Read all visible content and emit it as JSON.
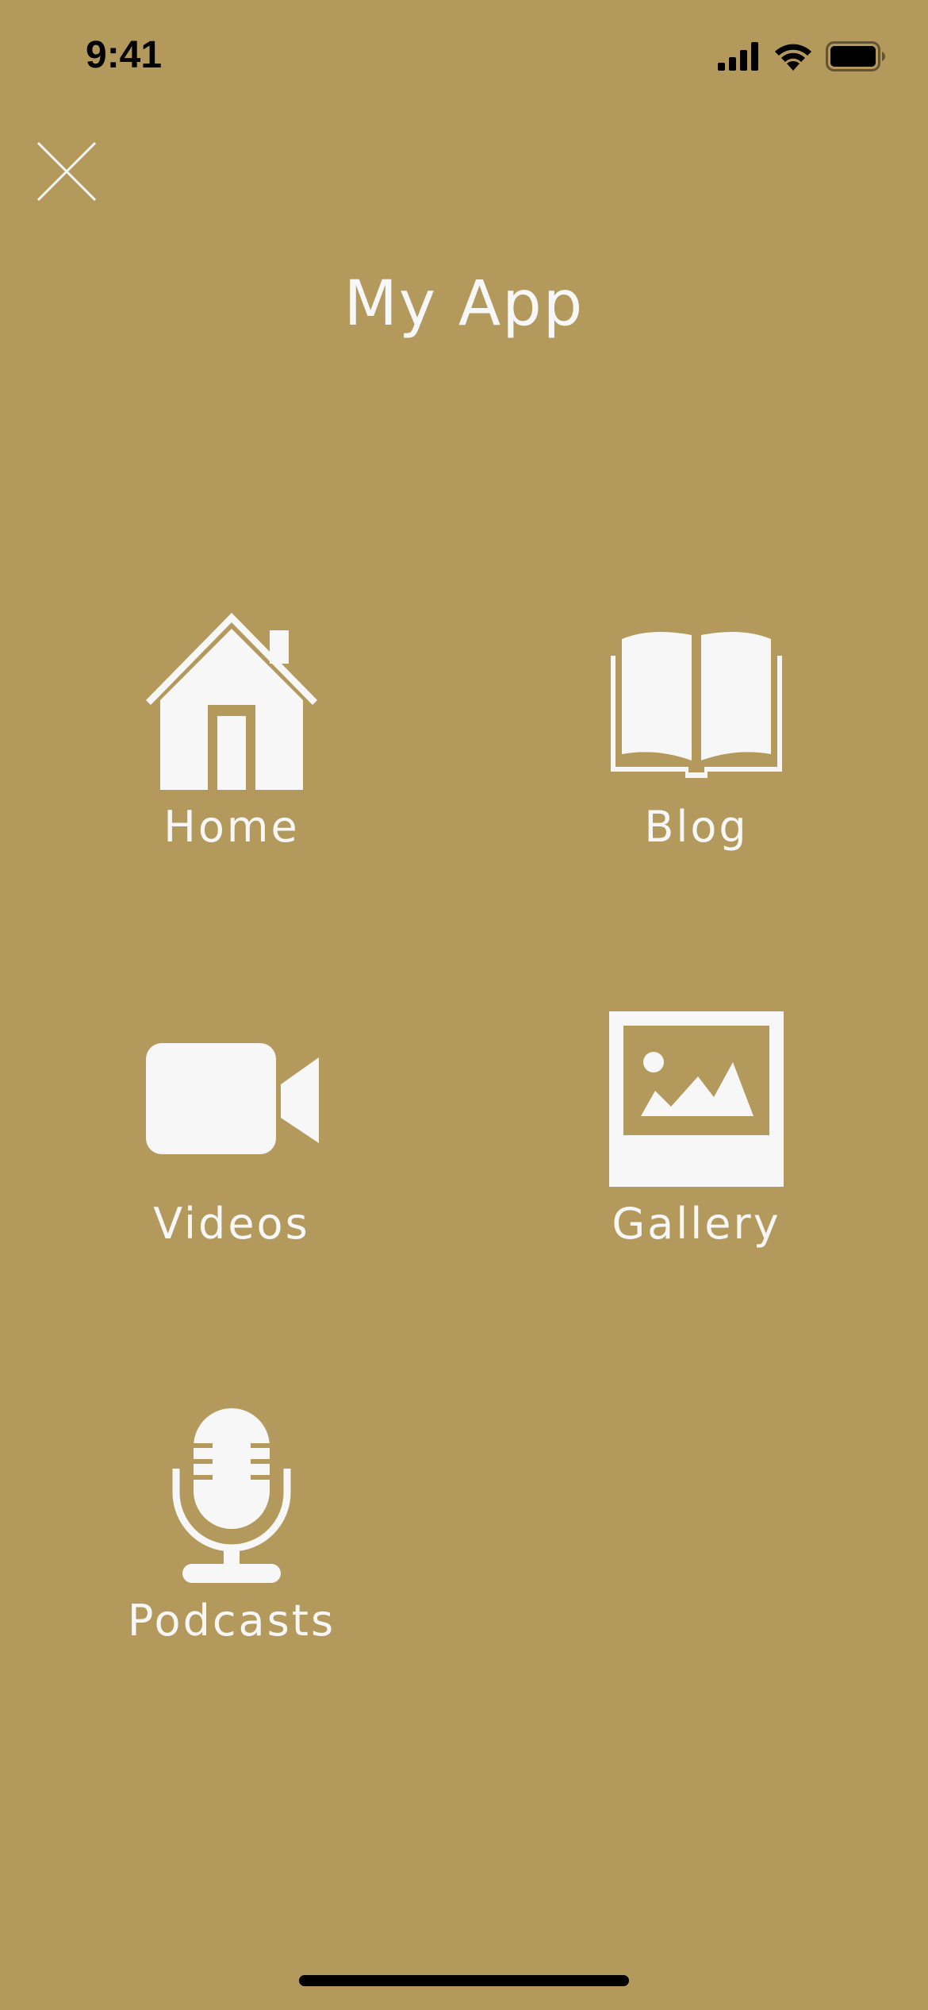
{
  "status_bar": {
    "time": "9:41",
    "signal_icon": "cellular-signal-icon",
    "wifi_icon": "wifi-icon",
    "battery_icon": "battery-icon"
  },
  "close_icon": "close-icon",
  "app_title": "My App",
  "nav_items": [
    {
      "label": "Home",
      "icon": "house-icon"
    },
    {
      "label": "Blog",
      "icon": "open-book-icon"
    },
    {
      "label": "Videos",
      "icon": "video-camera-icon"
    },
    {
      "label": "Gallery",
      "icon": "picture-icon"
    },
    {
      "label": "Podcasts",
      "icon": "microphone-icon"
    }
  ],
  "colors": {
    "background": "#b3995c",
    "foreground": "#f7f7f7",
    "status_text": "#000000"
  }
}
